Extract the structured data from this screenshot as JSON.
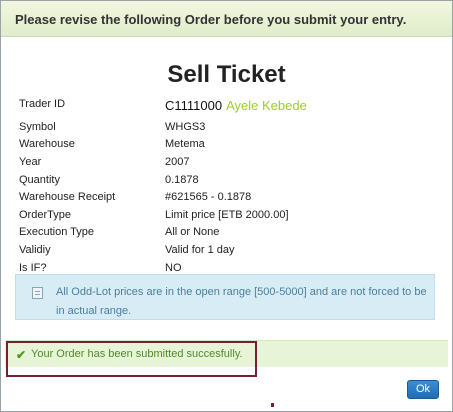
{
  "header": {
    "message": "Please revise the following Order before you submit your entry."
  },
  "title": "Sell Ticket",
  "fields": [
    {
      "label": "Trader ID",
      "value": "C1111000",
      "extra": "Ayele Kebede"
    },
    {
      "label": "Symbol",
      "value": "WHGS3"
    },
    {
      "label": "Warehouse",
      "value": "Metema"
    },
    {
      "label": "Year",
      "value": "2007"
    },
    {
      "label": "Quantity",
      "value": "0.1878"
    },
    {
      "label": "Warehouse Receipt",
      "value": "#621565 - 0.1878"
    },
    {
      "label": "OrderType",
      "value": "Limit price [ETB 2000.00]"
    },
    {
      "label": "Execution Type",
      "value": "All or None"
    },
    {
      "label": "Validiy",
      "value": "Valid for 1 day"
    },
    {
      "label": "Is IF?",
      "value": "NO"
    }
  ],
  "info": {
    "text": "All Odd-Lot prices are in the open range [500-5000] and are not forced to be in actual range."
  },
  "success": {
    "text": "Your Order has been submitted succesfully."
  },
  "buttons": {
    "ok": "Ok"
  },
  "colors": {
    "trader_name": "#9ccd2a",
    "success_text": "#4f8a27",
    "info_text": "#4a7e9c",
    "ok_button": "#1f6cb3"
  }
}
